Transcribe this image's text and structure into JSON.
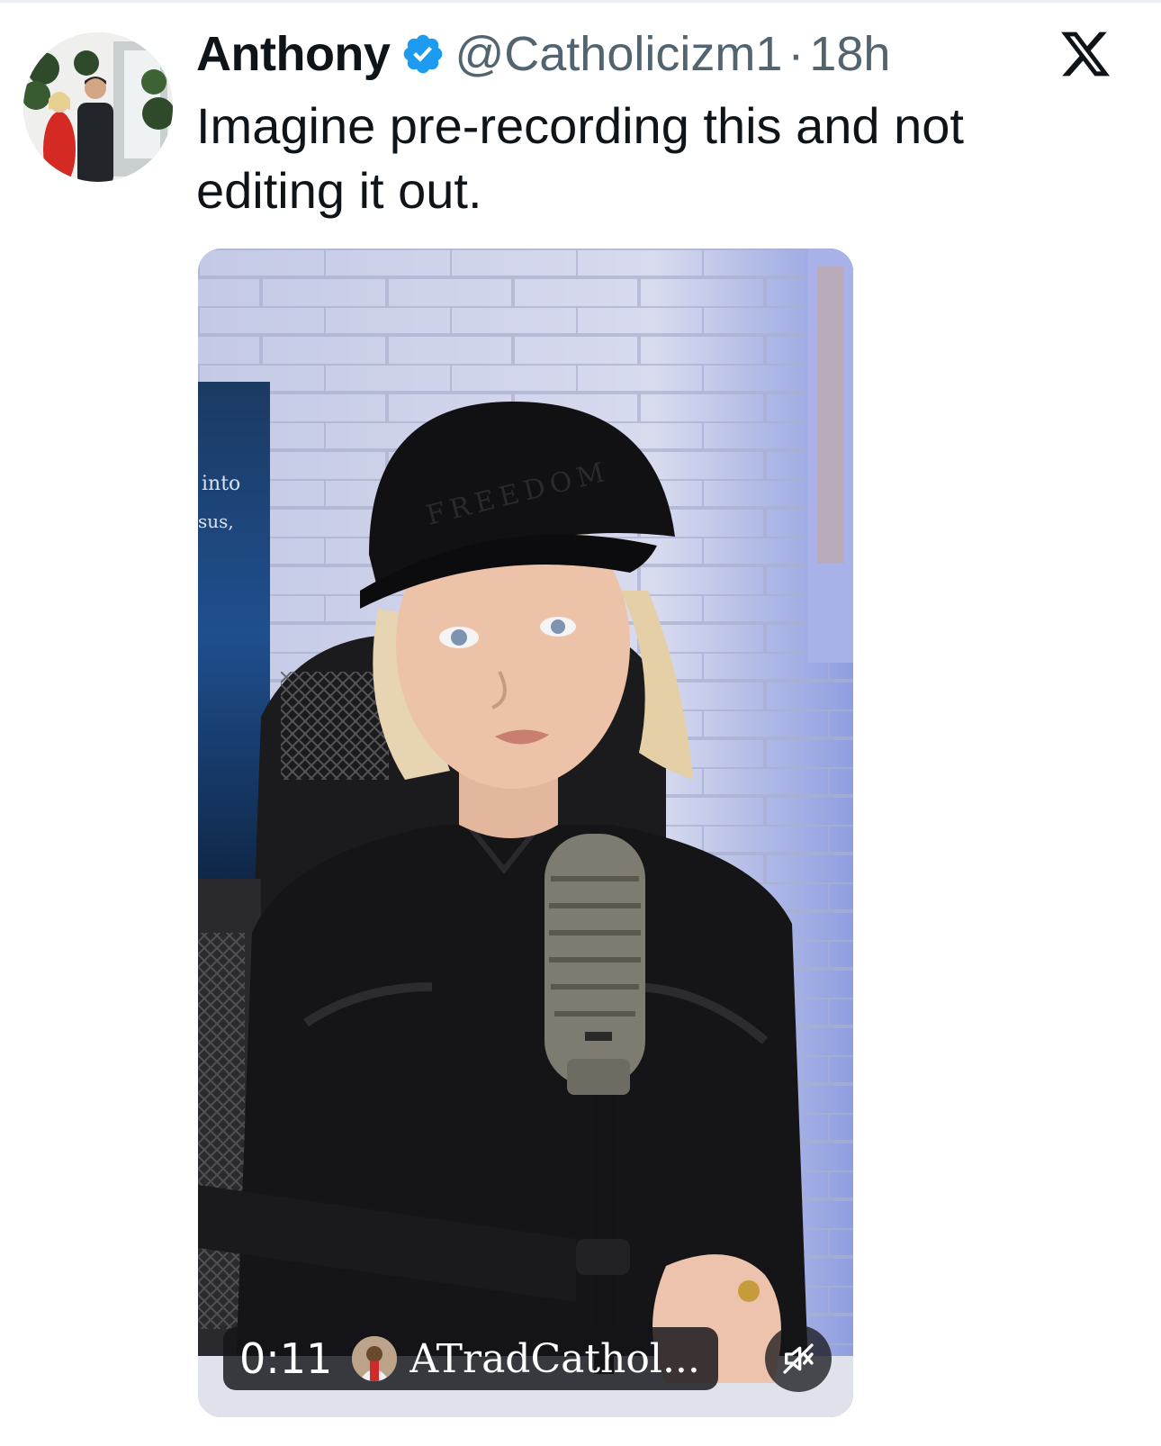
{
  "author": {
    "name": "Anthony",
    "handle": "@Catholicizm1",
    "separator": "·",
    "timestamp": "18h",
    "verified": true,
    "badge_color": "#1d9bf0"
  },
  "tweet": {
    "text": "Imagine pre-recording this and not editing it out."
  },
  "video": {
    "duration": "0:11",
    "channel_name": "ATradCathol...",
    "mute_icon": "speaker-muted-icon"
  },
  "icons": {
    "close": "x-logo-icon",
    "verified": "verified-badge-icon"
  },
  "scene": {
    "hat_text": "FREEDOM",
    "poster_text_1": "into",
    "poster_text_2": "sus,"
  }
}
